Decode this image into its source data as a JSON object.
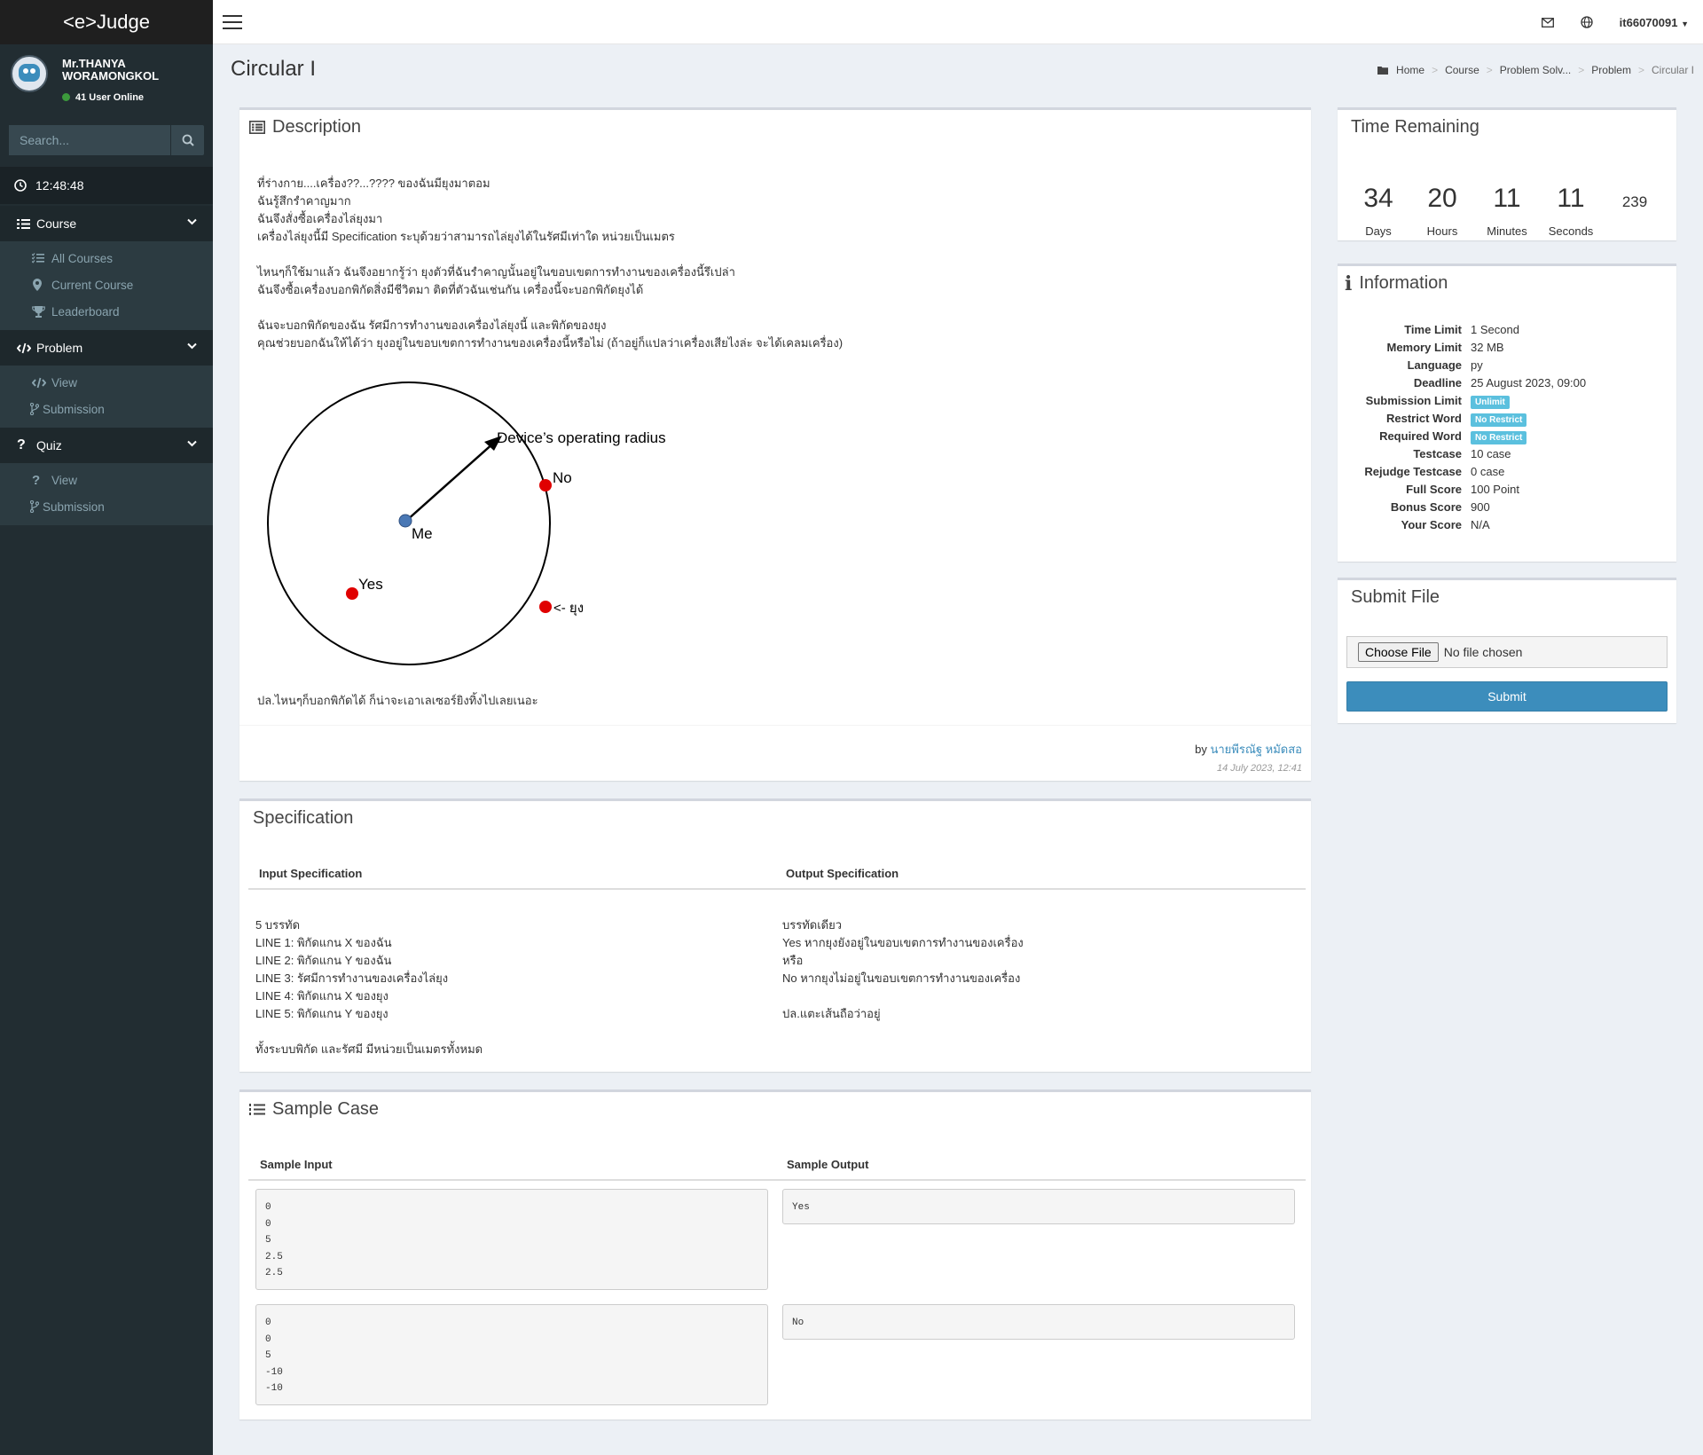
{
  "app": {
    "logo": "<e>Judge"
  },
  "user": {
    "name": "Mr.THANYA WORAMONGKOL",
    "online": "41 User Online"
  },
  "search": {
    "placeholder": "Search..."
  },
  "clock": "12:48:48",
  "sidebar": {
    "course": {
      "label": "Course",
      "items": [
        "All Courses",
        "Current Course",
        "Leaderboard"
      ]
    },
    "problem": {
      "label": "Problem",
      "items": [
        "View",
        "Submission"
      ]
    },
    "quiz": {
      "label": "Quiz",
      "items": [
        "View",
        "Submission"
      ]
    }
  },
  "topbar": {
    "username": "it66070091"
  },
  "page": {
    "title": "Circular I"
  },
  "breadcrumb": [
    "Home",
    "Course",
    "Problem Solv...",
    "Problem",
    "Circular I"
  ],
  "description": {
    "title": "Description",
    "lines": [
      "ที่ร่างกาย....เครื่อง??...???? ของฉันมียุงมาตอม",
      "ฉันรู้สึกรำคาญมาก",
      "ฉันจึงสั่งซื้อเครื่องไล่ยุงมา",
      "เครื่องไล่ยุงนี้มี Specification ระบุด้วยว่าสามารถไล่ยุงได้ในรัศมีเท่าใด หน่วยเป็นเมตร",
      "",
      "ไหนๆก็ใช้มาแล้ว ฉันจึงอยากรู้ว่า ยุงตัวที่ฉันรำคาญนั้นอยู่ในขอบเขตการทำงานของเครื่องนี้รึเปล่า",
      "ฉันจึงซื้อเครื่องบอกพิกัดสิ่งมีชีวิตมา ติดที่ตัวฉันเช่นกัน เครื่องนี้จะบอกพิกัดยุงได้",
      "",
      "ฉันจะบอกพิกัดของฉัน รัศมีการทำงานของเครื่องไล่ยุงนี้ และพิกัดของยุง",
      "คุณช่วยบอกฉันให้ได้ว่า ยุงอยู่ในขอบเขตการทำงานของเครื่องนี้หรือไม่ (ถ้าอยู่ก็แปลว่าเครื่องเสียไงล่ะ จะได้เคลมเครื่อง)"
    ],
    "diagram": {
      "radius_label": "Device’s operating radius",
      "center": "Me",
      "yes": "Yes",
      "no": "No",
      "mosquito": "<- ยุง"
    },
    "ps": "ปล.ไหนๆก็บอกพิกัดได้ ก็น่าจะเอาเลเซอร์ยิงทิ้งไปเลยเนอะ",
    "by_prefix": "by",
    "author": "นายพีรณัฐ หมัดสอ",
    "date": "14 July 2023, 12:41"
  },
  "specification": {
    "title": "Specification",
    "input_header": "Input Specification",
    "output_header": "Output Specification",
    "input_lines": [
      "5 บรรทัด",
      "LINE 1: พิกัดแกน X ของฉัน",
      "LINE 2: พิกัดแกน Y ของฉัน",
      "LINE 3: รัศมีการทำงานของเครื่องไล่ยุง",
      "LINE 4: พิกัดแกน X ของยุง",
      "LINE 5: พิกัดแกน Y ของยุง",
      "",
      "ทั้งระบบพิกัด และรัศมี มีหน่วยเป็นเมตรทั้งหมด"
    ],
    "output_lines": [
      "บรรทัดเดียว",
      "Yes หากยุงยังอยู่ในขอบเขตการทำงานของเครื่อง",
      "หรือ",
      "No หากยุงไม่อยู่ในขอบเขตการทำงานของเครื่อง",
      "",
      "ปล.แตะเส้นถือว่าอยู่"
    ]
  },
  "sample": {
    "title": "Sample Case",
    "input_header": "Sample Input",
    "output_header": "Sample Output",
    "cases": [
      {
        "input": "0\n0\n5\n2.5\n2.5",
        "output": "Yes"
      },
      {
        "input": "0\n0\n5\n-10\n-10",
        "output": "No"
      }
    ]
  },
  "time_remaining": {
    "title": "Time Remaining",
    "days": "34",
    "hours": "20",
    "minutes": "11",
    "seconds": "11",
    "ms": "239",
    "labels": [
      "Days",
      "Hours",
      "Minutes",
      "Seconds"
    ]
  },
  "information": {
    "title": "Information",
    "rows": [
      {
        "k": "Time Limit",
        "v": "1 Second"
      },
      {
        "k": "Memory Limit",
        "v": "32 MB"
      },
      {
        "k": "Language",
        "v": "py"
      },
      {
        "k": "Deadline",
        "v": "25 August 2023, 09:00"
      },
      {
        "k": "Submission Limit",
        "v": "Unlimit",
        "badge": true
      },
      {
        "k": "Restrict Word",
        "v": "No Restrict",
        "badge": true
      },
      {
        "k": "Required Word",
        "v": "No Restrict",
        "badge": true
      },
      {
        "k": "Testcase",
        "v": "10 case"
      },
      {
        "k": "Rejudge Testcase",
        "v": "0 case"
      },
      {
        "k": "Full Score",
        "v": "100 Point"
      },
      {
        "k": "Bonus Score",
        "v": "900"
      },
      {
        "k": "Your Score",
        "v": "N/A"
      }
    ]
  },
  "submit": {
    "title": "Submit File",
    "choose": "Choose File",
    "nofile": "No file chosen",
    "button": "Submit"
  },
  "colors": {
    "sidebar": "#222d32",
    "accent": "#3c8dbc",
    "badge": "#5bc0de",
    "red": "#e00000",
    "blue": "#4a78b5"
  }
}
